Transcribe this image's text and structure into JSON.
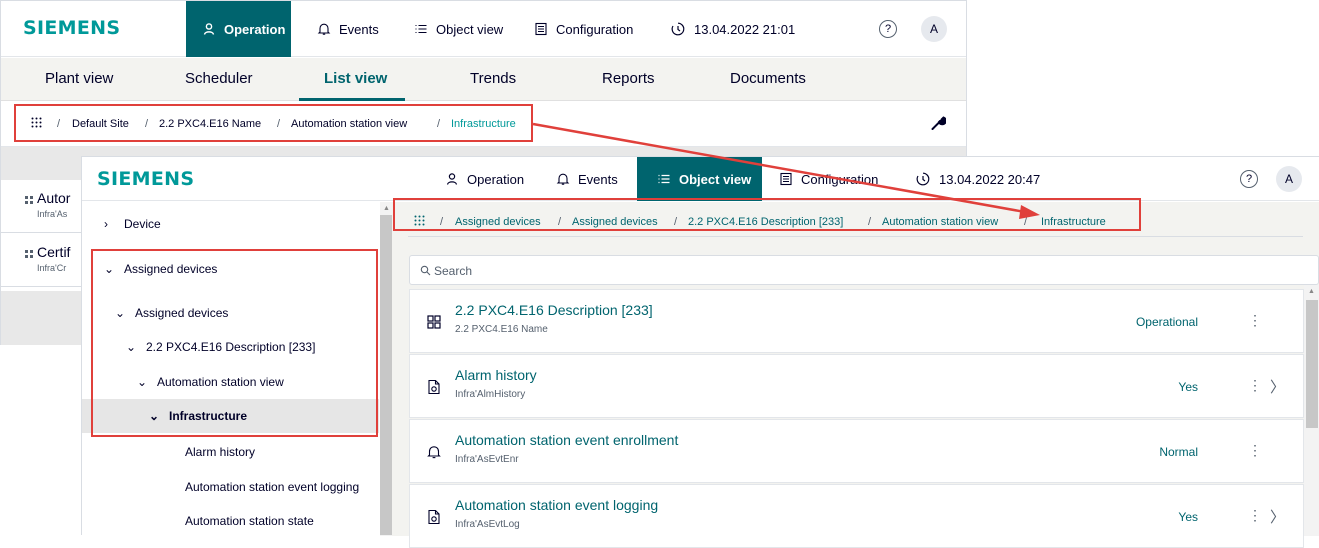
{
  "brand": "SIEMENS",
  "colors": {
    "brand": "#009999",
    "accent": "#00646e",
    "annotation": "#e0403b"
  },
  "back_window": {
    "nav": [
      {
        "label": "Operation",
        "icon": "operator-icon",
        "active": true
      },
      {
        "label": "Events",
        "icon": "bell-icon"
      },
      {
        "label": "Object view",
        "icon": "list-icon"
      },
      {
        "label": "Configuration",
        "icon": "configuration-icon"
      }
    ],
    "datetime": "13.04.2022 21:01",
    "avatar": "A",
    "tabs": [
      "Plant view",
      "Scheduler",
      "List view",
      "Trends",
      "Reports",
      "Documents"
    ],
    "active_tab": "List view",
    "breadcrumb": [
      "Default Site",
      "2.2 PXC4.E16 Name",
      "Automation station view",
      "Infrastructure"
    ],
    "list": [
      {
        "title": "Autor",
        "sub": "Infra'As"
      },
      {
        "title": "Certif",
        "sub": "Infra'Cr"
      }
    ]
  },
  "front_window": {
    "nav": [
      {
        "label": "Operation",
        "icon": "operator-icon"
      },
      {
        "label": "Events",
        "icon": "bell-icon"
      },
      {
        "label": "Object view",
        "icon": "list-icon",
        "active": true
      },
      {
        "label": "Configuration",
        "icon": "configuration-icon"
      }
    ],
    "datetime": "13.04.2022 20:47",
    "avatar": "A",
    "tree": [
      {
        "label": "Device",
        "chevron": "›"
      },
      {
        "label": "Assigned devices",
        "chevron": "⌄"
      },
      {
        "label": "Assigned devices",
        "chevron": "⌄"
      },
      {
        "label": "2.2 PXC4.E16 Description [233]",
        "chevron": "⌄"
      },
      {
        "label": "Automation station view",
        "chevron": "⌄"
      },
      {
        "label": "Infrastructure",
        "chevron": "⌄",
        "selected": true
      },
      {
        "label": "Alarm history"
      },
      {
        "label": "Automation station event logging"
      },
      {
        "label": "Automation station state"
      }
    ],
    "breadcrumb": [
      "Assigned devices",
      "Assigned devices",
      "2.2 PXC4.E16 Description [233]",
      "Automation station view",
      "Infrastructure"
    ],
    "search_placeholder": "Search",
    "rows": [
      {
        "title": "2.2 PXC4.E16 Description [233]",
        "sub": "2.2 PXC4.E16 Name",
        "status": "Operational",
        "icon": "grid-icon",
        "more": "⋮",
        "go": ""
      },
      {
        "title": "Alarm history",
        "sub": "Infra'AlmHistory",
        "status": "Yes",
        "icon": "document-icon",
        "more": "⋮",
        "go": "〉"
      },
      {
        "title": "Automation station event enrollment",
        "sub": "Infra'AsEvtEnr",
        "status": "Normal",
        "icon": "bell-icon",
        "more": "⋮",
        "go": ""
      },
      {
        "title": "Automation station event logging",
        "sub": "Infra'AsEvtLog",
        "status": "Yes",
        "icon": "document-icon",
        "more": "⋮",
        "go": "〉"
      }
    ]
  }
}
